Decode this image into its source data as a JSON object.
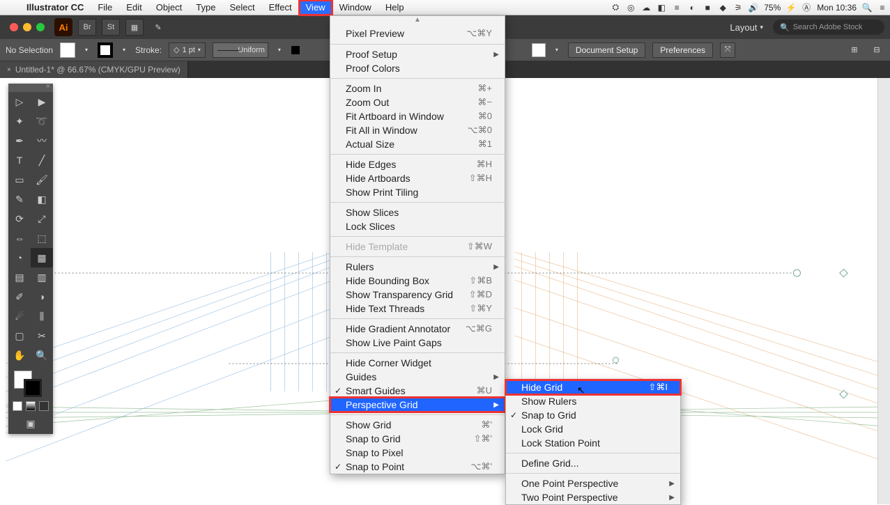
{
  "menubar": {
    "appname": "Illustrator CC",
    "items": [
      "File",
      "Edit",
      "Object",
      "Type",
      "Select",
      "Effect",
      "View",
      "Window",
      "Help"
    ],
    "battery": "75%",
    "clock": "Mon 10:36"
  },
  "toolbar": {
    "layout_label": "Layout",
    "search_placeholder": "Search Adobe Stock"
  },
  "controlbar": {
    "selection": "No Selection",
    "stroke_label": "Stroke:",
    "stroke_val": "1 pt",
    "brush_profile": "Uniform",
    "doc_setup": "Document Setup",
    "preferences": "Preferences"
  },
  "tab": {
    "title": "Untitled-1* @ 66.67% (CMYK/GPU Preview)"
  },
  "view_menu": {
    "pixel_preview": "Pixel Preview",
    "pixel_preview_sc": "⌥⌘Y",
    "proof_setup": "Proof Setup",
    "proof_colors": "Proof Colors",
    "zoom_in": "Zoom In",
    "zoom_in_sc": "⌘+",
    "zoom_out": "Zoom Out",
    "zoom_out_sc": "⌘−",
    "fit_artboard": "Fit Artboard in Window",
    "fit_artboard_sc": "⌘0",
    "fit_all": "Fit All in Window",
    "fit_all_sc": "⌥⌘0",
    "actual_size": "Actual Size",
    "actual_size_sc": "⌘1",
    "hide_edges": "Hide Edges",
    "hide_edges_sc": "⌘H",
    "hide_artboards": "Hide Artboards",
    "hide_artboards_sc": "⇧⌘H",
    "show_print_tiling": "Show Print Tiling",
    "show_slices": "Show Slices",
    "lock_slices": "Lock Slices",
    "hide_template": "Hide Template",
    "hide_template_sc": "⇧⌘W",
    "rulers": "Rulers",
    "hide_bb": "Hide Bounding Box",
    "hide_bb_sc": "⇧⌘B",
    "show_transp": "Show Transparency Grid",
    "show_transp_sc": "⇧⌘D",
    "hide_text_threads": "Hide Text Threads",
    "hide_text_threads_sc": "⇧⌘Y",
    "hide_grad": "Hide Gradient Annotator",
    "hide_grad_sc": "⌥⌘G",
    "live_paint": "Show Live Paint Gaps",
    "hide_corner": "Hide Corner Widget",
    "guides": "Guides",
    "smart_guides": "Smart Guides",
    "smart_guides_sc": "⌘U",
    "perspective_grid": "Perspective Grid",
    "show_grid": "Show Grid",
    "show_grid_sc": "⌘'",
    "snap_grid": "Snap to Grid",
    "snap_grid_sc": "⇧⌘'",
    "snap_pixel": "Snap to Pixel",
    "snap_point": "Snap to Point",
    "snap_point_sc": "⌥⌘'"
  },
  "submenu": {
    "hide_grid": "Hide Grid",
    "hide_grid_sc": "⇧⌘I",
    "show_rulers": "Show Rulers",
    "snap_to_grid": "Snap to Grid",
    "lock_grid": "Lock Grid",
    "lock_station": "Lock Station Point",
    "define_grid": "Define Grid...",
    "one_point": "One Point Perspective",
    "two_point": "Two Point Perspective"
  }
}
